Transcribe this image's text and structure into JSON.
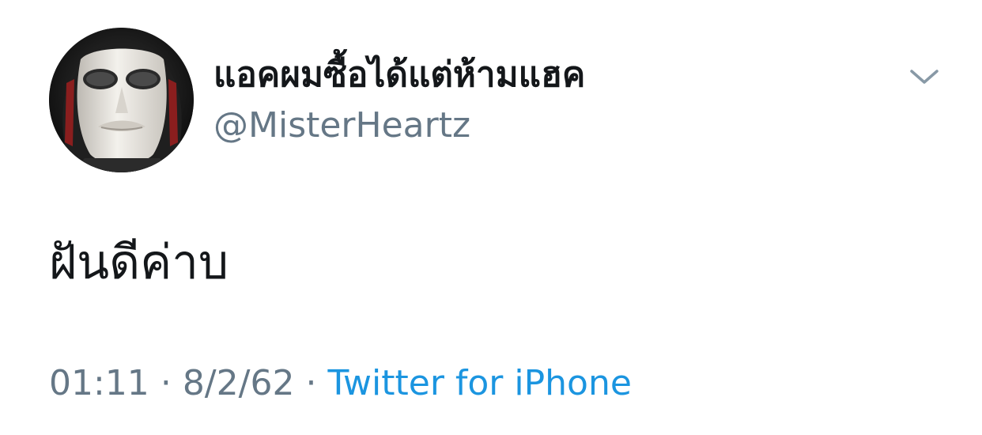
{
  "tweet": {
    "author": {
      "display_name": "แอคผมซื้อได้แต่ห้ามแฮค",
      "handle": "@MisterHeartz",
      "avatar_icon": "white-mask-avatar"
    },
    "menu_icon": "chevron-down-icon",
    "text": "ฝันดีค่าบ",
    "time": "01:11",
    "separator": "·",
    "date": "8/2/62",
    "source": "Twitter for iPhone"
  },
  "colors": {
    "name": "#14171a",
    "secondary": "#657786",
    "link": "#1b95e0",
    "caret": "#8899a6"
  }
}
